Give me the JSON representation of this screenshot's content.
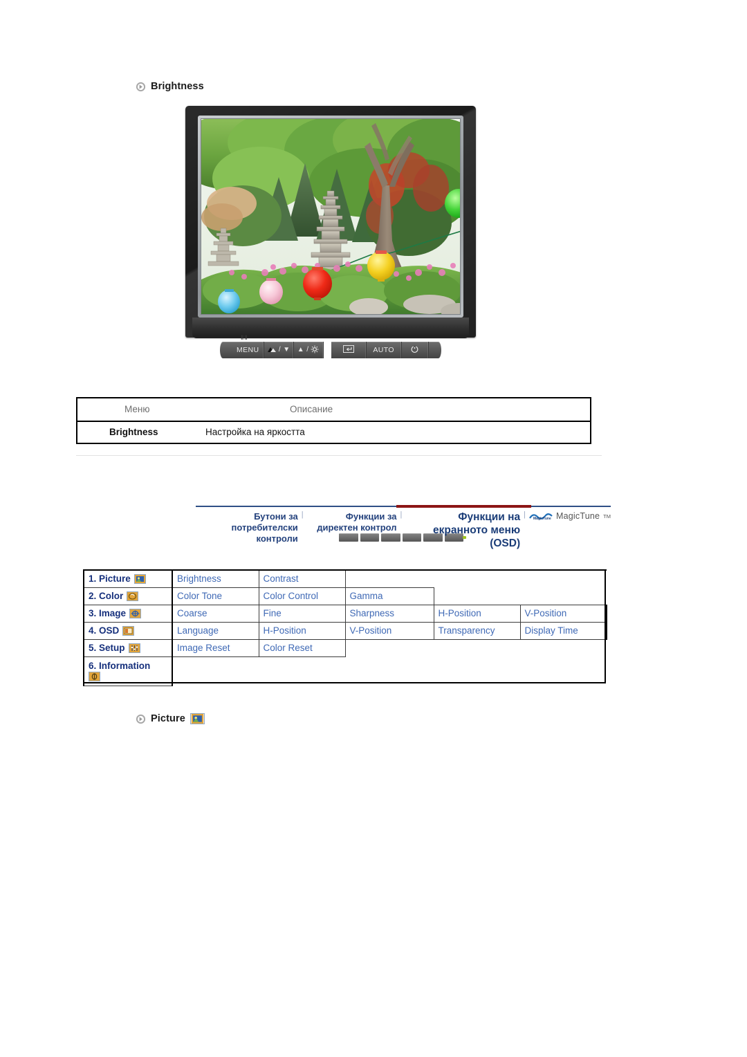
{
  "page": {
    "brightness_heading": "Brightness",
    "picture_heading": "Picture",
    "bullet_icon": "arrow-bullet-icon"
  },
  "monitor": {
    "alt": "Samsung LCD monitor displaying a Korean garden with stone pagodas and paper lanterns",
    "controls": [
      {
        "name": "menu-button",
        "label": "MENU",
        "icon": "menu-icon"
      },
      {
        "name": "brightness-down-button",
        "label": "/ ▼",
        "icon": "brightness-icon"
      },
      {
        "name": "brightness-up-button",
        "label": "▲ /",
        "icon": "gear-icon"
      },
      {
        "name": "enter-button",
        "label": "",
        "icon": "enter-icon"
      },
      {
        "name": "auto-button",
        "label": "AUTO",
        "icon": ""
      },
      {
        "name": "power-button",
        "label": "",
        "icon": "power-icon"
      }
    ],
    "menu_marker": "ⅡⅡ"
  },
  "description_table": {
    "headers": {
      "menu": "Меню",
      "description": "Описание"
    },
    "rows": [
      {
        "menu": "Brightness",
        "description": "Настройка на яркостта"
      }
    ]
  },
  "nav_tabs": {
    "items": [
      {
        "label": "Бутони за\nпотребителски контроли",
        "active": false
      },
      {
        "label": "Функции за\nдиректен контрол",
        "active": false
      },
      {
        "label": "Функции на\nекранното меню (OSD)",
        "active": true
      }
    ],
    "separator": "|",
    "magictune": {
      "name": "MagicTune",
      "tm": "TM",
      "logo_icon": "magictune-logo-icon"
    },
    "colors": {
      "inactive_rule": "#2f4f86",
      "active_rule": "#8c1616",
      "label": "#24427d"
    }
  },
  "osd_matrix": {
    "rows": [
      {
        "category": "1. Picture",
        "icon": "picture-icon",
        "items": [
          "Brightness",
          "Contrast"
        ]
      },
      {
        "category": "2. Color",
        "icon": "color-icon",
        "items": [
          "Color Tone",
          "Color Control",
          "Gamma"
        ]
      },
      {
        "category": "3. Image",
        "icon": "image-icon",
        "items": [
          "Coarse",
          "Fine",
          "Sharpness",
          "H-Position",
          "V-Position"
        ]
      },
      {
        "category": "4. OSD",
        "icon": "osd-icon",
        "items": [
          "Language",
          "H-Position",
          "V-Position",
          "Transparency",
          "Display Time"
        ]
      },
      {
        "category": "5. Setup",
        "icon": "setup-icon",
        "items": [
          "Image Reset",
          "Color Reset"
        ]
      },
      {
        "category": "6. Information",
        "icon": "information-icon",
        "items": []
      }
    ],
    "colors": {
      "category_text": "#16307c",
      "item_text": "#3f69b5",
      "border": "#000000"
    }
  }
}
